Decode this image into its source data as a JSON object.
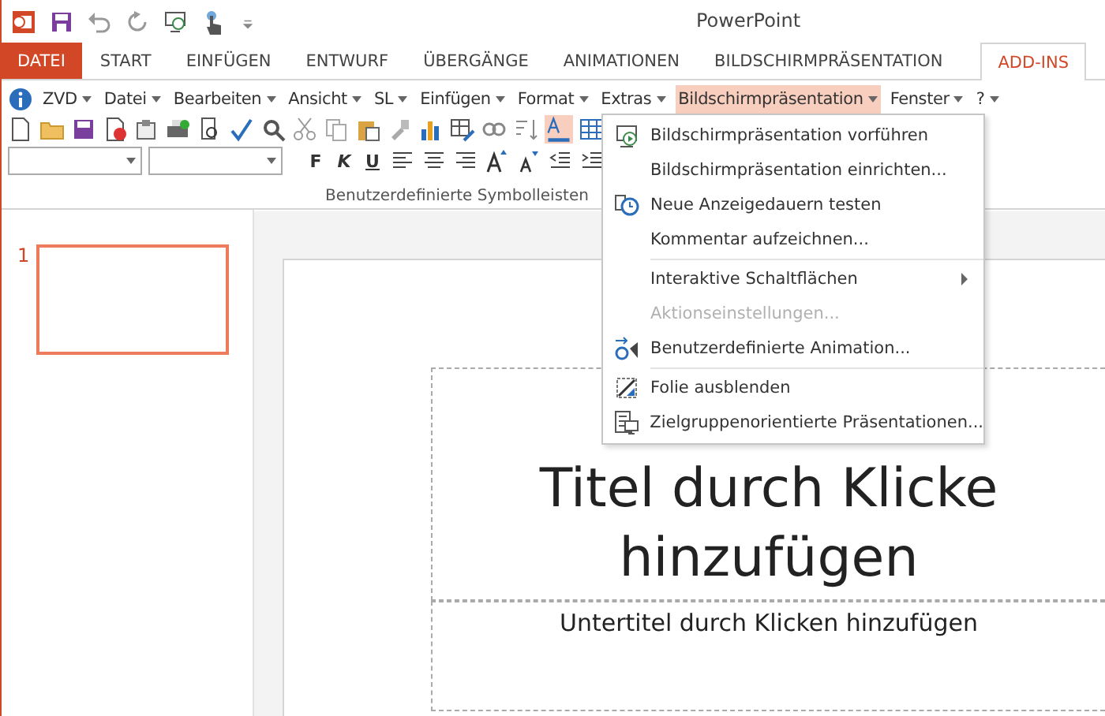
{
  "window": {
    "title": "PowerPoint"
  },
  "tabs": [
    {
      "label": "DATEI",
      "kind": "file",
      "selected": false
    },
    {
      "label": "START",
      "kind": "tab",
      "selected": false
    },
    {
      "label": "EINFÜGEN",
      "kind": "tab",
      "selected": false
    },
    {
      "label": "ENTWURF",
      "kind": "tab",
      "selected": false
    },
    {
      "label": "ÜBERGÄNGE",
      "kind": "tab",
      "selected": false
    },
    {
      "label": "ANIMATIONEN",
      "kind": "tab",
      "selected": false
    },
    {
      "label": "BILDSCHIRMPRÄSENTATION",
      "kind": "tab",
      "selected": false
    },
    {
      "label": "ADD-INS",
      "kind": "tab",
      "selected": true
    }
  ],
  "menubar": [
    {
      "label": "ZVD",
      "selected": false
    },
    {
      "label": "Datei",
      "selected": false
    },
    {
      "label": "Bearbeiten",
      "selected": false
    },
    {
      "label": "Ansicht",
      "selected": false
    },
    {
      "label": "SL",
      "selected": false
    },
    {
      "label": "Einfügen",
      "selected": false
    },
    {
      "label": "Format",
      "selected": false
    },
    {
      "label": "Extras",
      "selected": false
    },
    {
      "label": "Bildschirmpräsentation",
      "selected": true
    },
    {
      "label": "Fenster",
      "selected": false
    },
    {
      "label": "?",
      "selected": false
    }
  ],
  "format_buttons": [
    "F",
    "K",
    "U"
  ],
  "group_label": "Benutzerdefinierte Symbolleisten",
  "slide_number": "1",
  "slide": {
    "title_lines": [
      "Titel durch Klicke",
      "hinzufügen"
    ],
    "subtitle": "Untertitel durch Klicken hinzufügen"
  },
  "dropdown": [
    {
      "kind": "item",
      "label": "Bildschirmpräsentation vorführen",
      "disabled": false,
      "submenu": false
    },
    {
      "kind": "item",
      "label": "Bildschirmpräsentation einrichten...",
      "disabled": false,
      "submenu": false
    },
    {
      "kind": "item",
      "label": "Neue Anzeigedauern testen",
      "disabled": false,
      "submenu": false
    },
    {
      "kind": "item",
      "label": "Kommentar aufzeichnen...",
      "disabled": false,
      "submenu": false
    },
    {
      "kind": "separator"
    },
    {
      "kind": "item",
      "label": "Interaktive Schaltflächen",
      "disabled": false,
      "submenu": true
    },
    {
      "kind": "item",
      "label": "Aktionseinstellungen...",
      "disabled": true,
      "submenu": false
    },
    {
      "kind": "item",
      "label": "Benutzerdefinierte Animation...",
      "disabled": false,
      "submenu": false
    },
    {
      "kind": "separator"
    },
    {
      "kind": "item",
      "label": "Folie ausblenden",
      "disabled": false,
      "submenu": false
    },
    {
      "kind": "item",
      "label": "Zielgruppenorientierte Präsentationen...",
      "disabled": false,
      "submenu": false
    }
  ]
}
